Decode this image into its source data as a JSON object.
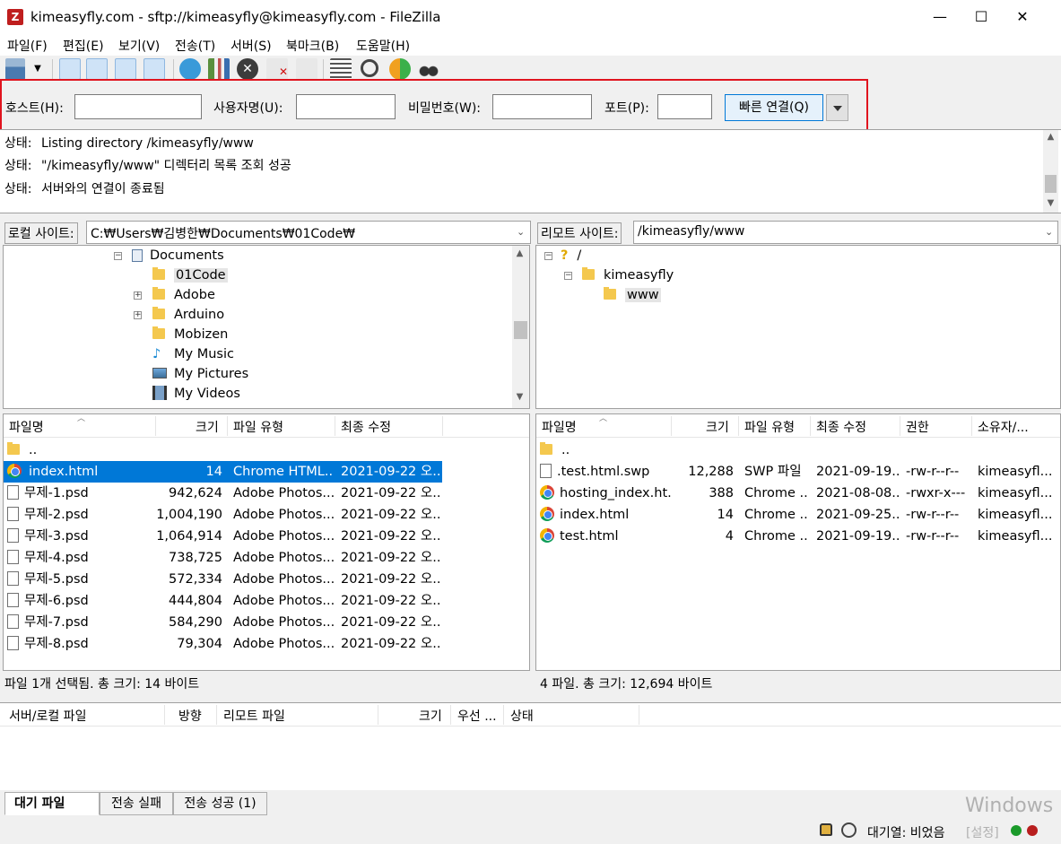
{
  "window": {
    "title": "kimeasyfly.com - sftp://kimeasyfly@kimeasyfly.com - FileZilla",
    "app_icon": "Z",
    "minimize": "—",
    "maximize": "☐",
    "close": "✕"
  },
  "menu": [
    "파일(F)",
    "편집(E)",
    "보기(V)",
    "전송(T)",
    "서버(S)",
    "북마크(B)",
    "도움말(H)"
  ],
  "toolbar": {
    "icons": [
      "site-manager-icon",
      "toggle-log-icon",
      "toggle-local-tree-icon",
      "toggle-remote-tree-icon",
      "toggle-queue-icon",
      "refresh-icon",
      "process-queue-icon",
      "cancel-icon",
      "disconnect-icon",
      "reconnect-icon",
      "filter-icon",
      "compare-icon",
      "sync-browse-icon",
      "search-icon"
    ]
  },
  "quickconnect": {
    "host_label": "호스트(H):",
    "user_label": "사용자명(U):",
    "pass_label": "비밀번호(W):",
    "port_label": "포트(P):",
    "button": "빠른 연결(Q)",
    "host": "",
    "user": "",
    "pass": "",
    "port": ""
  },
  "log": [
    {
      "prefix": "상태:",
      "text": "Listing directory /kimeasyfly/www"
    },
    {
      "prefix": "상태:",
      "text": "\"/kimeasyfly/www\" 디렉터리 목록 조회 성공"
    },
    {
      "prefix": "상태:",
      "text": "서버와의 연결이 종료됨"
    }
  ],
  "local": {
    "site_label": "로컬 사이트:",
    "path": "C:₩Users₩김병한₩Documents₩01Code₩",
    "tree": [
      "Documents",
      "01Code",
      "Adobe",
      "Arduino",
      "Mobizen",
      "My Music",
      "My Pictures",
      "My Videos"
    ],
    "headers": [
      "파일명",
      "크기",
      "파일 유형",
      "최종 수정"
    ],
    "files": [
      {
        "name": "..",
        "size": "",
        "type": "",
        "modified": ""
      },
      {
        "name": "index.html",
        "size": "14",
        "type": "Chrome HTML...",
        "modified": "2021-09-22 오..."
      },
      {
        "name": "무제-1.psd",
        "size": "942,624",
        "type": "Adobe Photos...",
        "modified": "2021-09-22 오..."
      },
      {
        "name": "무제-2.psd",
        "size": "1,004,190",
        "type": "Adobe Photos...",
        "modified": "2021-09-22 오..."
      },
      {
        "name": "무제-3.psd",
        "size": "1,064,914",
        "type": "Adobe Photos...",
        "modified": "2021-09-22 오..."
      },
      {
        "name": "무제-4.psd",
        "size": "738,725",
        "type": "Adobe Photos...",
        "modified": "2021-09-22 오..."
      },
      {
        "name": "무제-5.psd",
        "size": "572,334",
        "type": "Adobe Photos...",
        "modified": "2021-09-22 오..."
      },
      {
        "name": "무제-6.psd",
        "size": "444,804",
        "type": "Adobe Photos...",
        "modified": "2021-09-22 오..."
      },
      {
        "name": "무제-7.psd",
        "size": "584,290",
        "type": "Adobe Photos...",
        "modified": "2021-09-22 오..."
      },
      {
        "name": "무제-8.psd",
        "size": "79,304",
        "type": "Adobe Photos...",
        "modified": "2021-09-22 오..."
      }
    ],
    "status": "파일 1개 선택됨. 총 크기: 14 바이트"
  },
  "remote": {
    "site_label": "리모트 사이트:",
    "path": "/kimeasyfly/www",
    "tree": [
      "/",
      "kimeasyfly",
      "www"
    ],
    "headers": [
      "파일명",
      "크기",
      "파일 유형",
      "최종 수정",
      "권한",
      "소유자/..."
    ],
    "files": [
      {
        "name": "..",
        "size": "",
        "type": "",
        "modified": "",
        "perm": "",
        "owner": ""
      },
      {
        "name": ".test.html.swp",
        "size": "12,288",
        "type": "SWP 파일",
        "modified": "2021-09-19...",
        "perm": "-rw-r--r--",
        "owner": "kimeasyfl..."
      },
      {
        "name": "hosting_index.ht...",
        "size": "388",
        "type": "Chrome ...",
        "modified": "2021-08-08...",
        "perm": "-rwxr-x---",
        "owner": "kimeasyfl..."
      },
      {
        "name": "index.html",
        "size": "14",
        "type": "Chrome ...",
        "modified": "2021-09-25...",
        "perm": "-rw-r--r--",
        "owner": "kimeasyfl..."
      },
      {
        "name": "test.html",
        "size": "4",
        "type": "Chrome ...",
        "modified": "2021-09-19...",
        "perm": "-rw-r--r--",
        "owner": "kimeasyfl..."
      }
    ],
    "status": "4 파일. 총 크기: 12,694 바이트"
  },
  "queue": {
    "headers": [
      "서버/로컬 파일",
      "방향",
      "리모트 파일",
      "크기",
      "우선 ...",
      "상태"
    ]
  },
  "tabs": [
    "대기 파일",
    "전송 실패",
    "전송 성공 (1)"
  ],
  "statusbar": {
    "queue_text": "대기열: 비었음",
    "watermark_line1": "Windows",
    "watermark_line2": "[설정]"
  }
}
